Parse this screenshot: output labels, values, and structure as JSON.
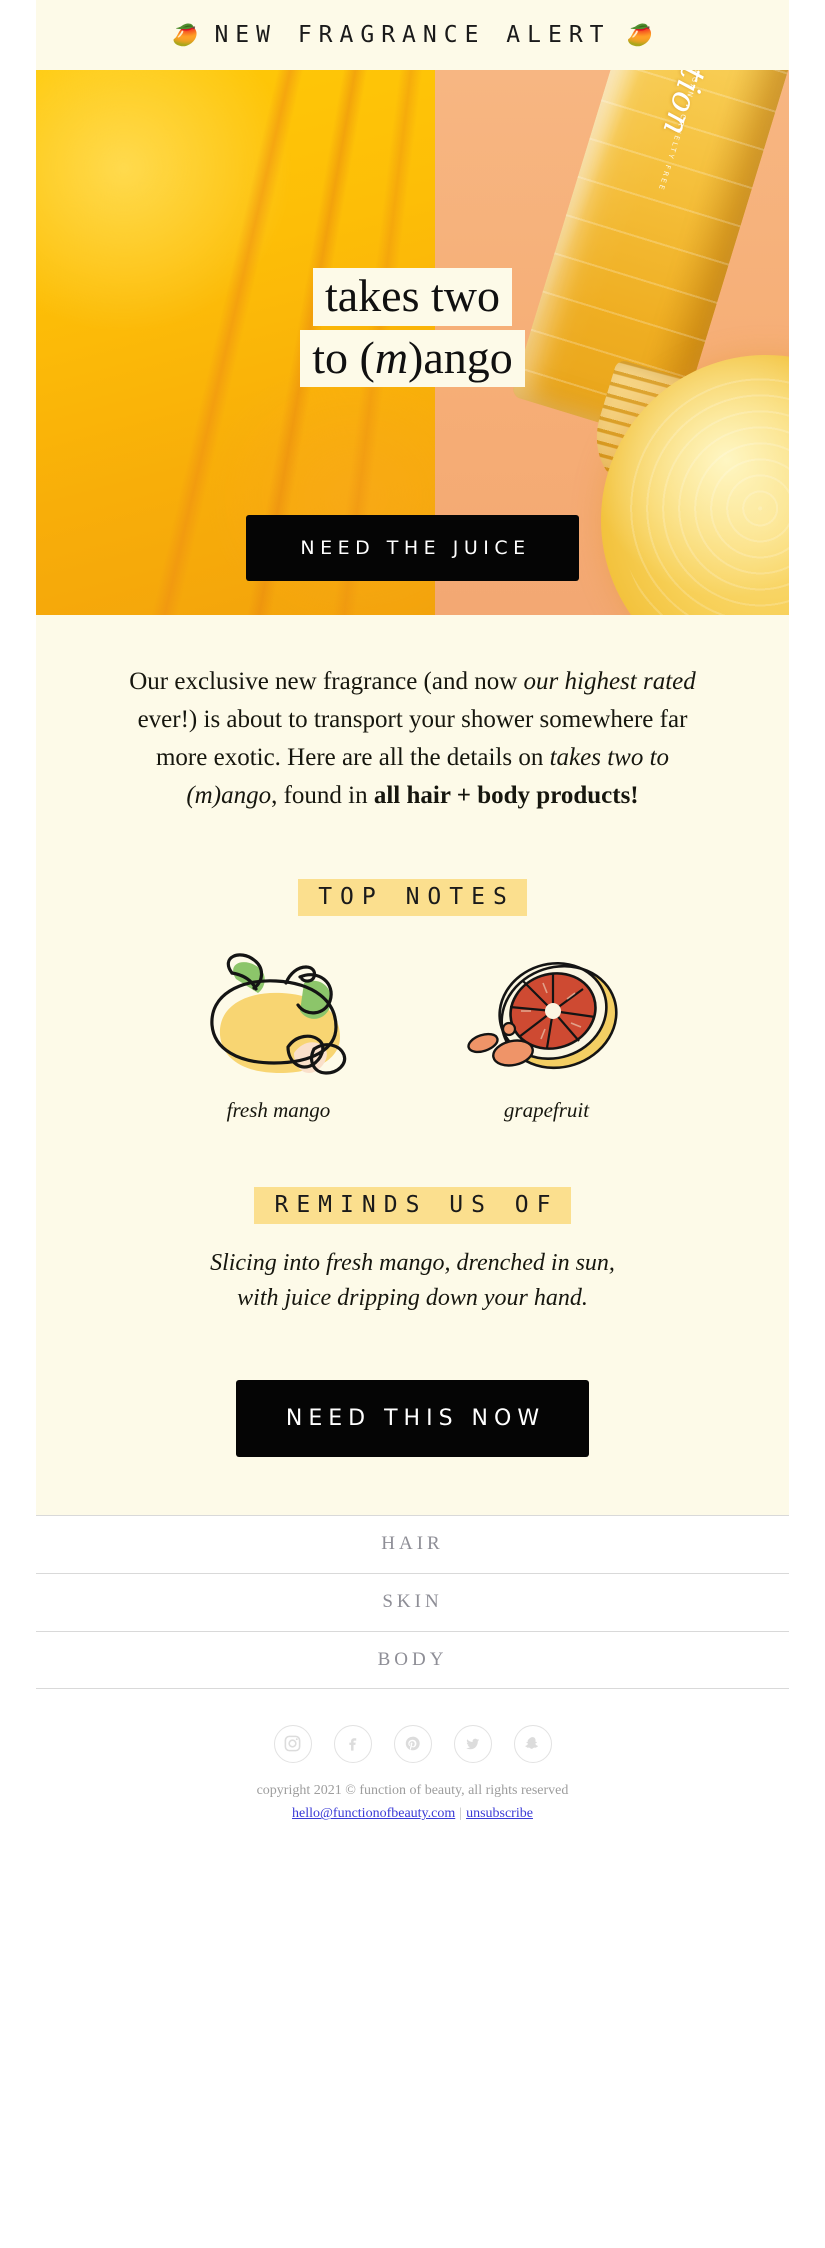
{
  "colors": {
    "cream_bg": "#FDFAE8",
    "page_bg": "#FFFFFF",
    "mango_yellow": "#FFC907",
    "peach": "#F6AE76",
    "highlight_band": "#FBDF8E",
    "button_black": "#050505",
    "footer_link_gray": "#8E8E96",
    "legal_link_blue": "#3A3AD6"
  },
  "header": {
    "alert_text": "NEW FRAGRANCE ALERT",
    "emoji_left": "🥭",
    "emoji_right": "🥭"
  },
  "hero": {
    "headline_line1": "takes two",
    "headline_line2_pre": "to (",
    "headline_line2_italic": "m",
    "headline_line2_post": ")ango",
    "bottle_brand": "function",
    "bottle_small_text": "VEGAN • CRUELTY FREE",
    "cta_label": "NEED THE JUICE"
  },
  "body": {
    "intro_1": "Our exclusive new fragrance (and now ",
    "intro_2_italic": "our highest rated",
    "intro_3": " ever!) is about to transport your shower somewhere far more exotic. Here are all the details on ",
    "intro_4_italic": "takes two to (m)ango",
    "intro_5": ", found in ",
    "intro_6_bold": "all hair + body products!",
    "top_notes_heading": "TOP NOTES",
    "notes": [
      {
        "label": "fresh mango",
        "art": "mango-illustration"
      },
      {
        "label": "grapefruit",
        "art": "grapefruit-illustration"
      }
    ],
    "reminds_heading": "REMINDS US OF",
    "reminds_copy_line1": "Slicing into fresh mango, drenched in sun,",
    "reminds_copy_line2": "with juice dripping down your hand.",
    "cta_label": "NEED THIS NOW"
  },
  "footer": {
    "nav": [
      {
        "label": "HAIR"
      },
      {
        "label": "SKIN"
      },
      {
        "label": "BODY"
      }
    ],
    "social": [
      {
        "name": "instagram-icon"
      },
      {
        "name": "facebook-icon"
      },
      {
        "name": "pinterest-icon"
      },
      {
        "name": "twitter-icon"
      },
      {
        "name": "snapchat-icon"
      }
    ],
    "copyright": "copyright 2021 © function of beauty, all rights reserved",
    "email_link": "hello@functionofbeauty.com",
    "separator": "|",
    "unsubscribe_label": "unsubscribe"
  }
}
